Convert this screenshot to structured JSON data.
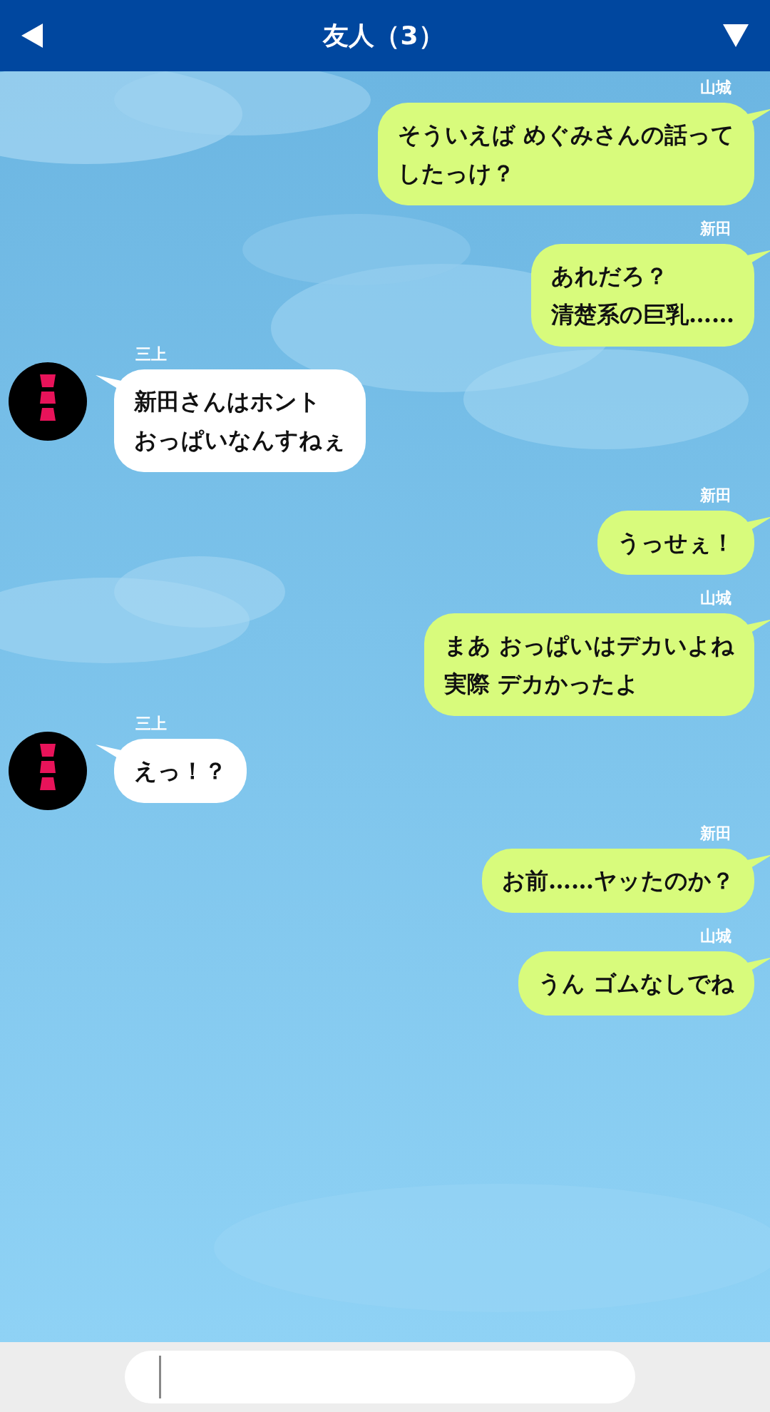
{
  "header": {
    "title": "友人（3）"
  },
  "messages": [
    {
      "kind": "sent",
      "sender": "山城",
      "lines": [
        "そういえば めぐみさんの話って",
        "したっけ？"
      ]
    },
    {
      "kind": "sent",
      "sender": "新田",
      "lines": [
        "あれだろ？",
        "清楚系の巨乳……"
      ]
    },
    {
      "kind": "received",
      "sender": "三上",
      "lines": [
        "新田さんはホント",
        "おっぱいなんすねぇ"
      ]
    },
    {
      "kind": "sent",
      "sender": "新田",
      "lines": [
        "うっせぇ！"
      ]
    },
    {
      "kind": "sent",
      "sender": "山城",
      "lines": [
        "まあ おっぱいはデカいよね",
        "実際 デカかったよ"
      ]
    },
    {
      "kind": "received",
      "sender": "三上",
      "lines": [
        "えっ！？"
      ]
    },
    {
      "kind": "sent",
      "sender": "新田",
      "lines": [
        "お前……ヤッたのか？"
      ]
    },
    {
      "kind": "sent",
      "sender": "山城",
      "lines": [
        "うん ゴムなしでね"
      ]
    }
  ]
}
